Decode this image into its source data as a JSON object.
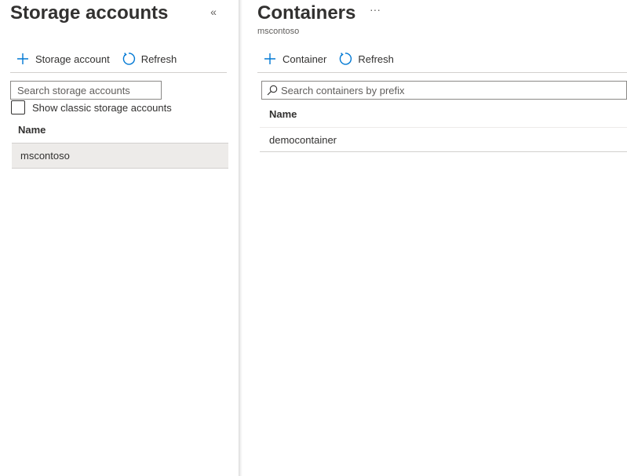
{
  "storage_accounts": {
    "title": "Storage accounts",
    "collapse_glyph": "«",
    "toolbar": {
      "add_label": "Storage account",
      "refresh_label": "Refresh"
    },
    "search": {
      "placeholder": "Search storage accounts"
    },
    "show_classic_label": "Show classic storage accounts",
    "show_classic_checked": false,
    "column_header": "Name",
    "rows": [
      {
        "name": "mscontoso",
        "selected": true
      }
    ]
  },
  "containers": {
    "title": "Containers",
    "more_glyph": "···",
    "subtitle": "mscontoso",
    "toolbar": {
      "add_label": "Container",
      "refresh_label": "Refresh"
    },
    "search": {
      "placeholder": "Search containers by prefix"
    },
    "column_header": "Name",
    "rows": [
      {
        "name": "democontainer"
      }
    ]
  },
  "colors": {
    "accent": "#0078d4",
    "selected_row": "#edebe9",
    "text": "#323130"
  },
  "icons": {
    "add": "plus-icon",
    "refresh": "refresh-icon",
    "search": "search-icon",
    "collapse": "collapse-icon",
    "more": "more-icon"
  }
}
